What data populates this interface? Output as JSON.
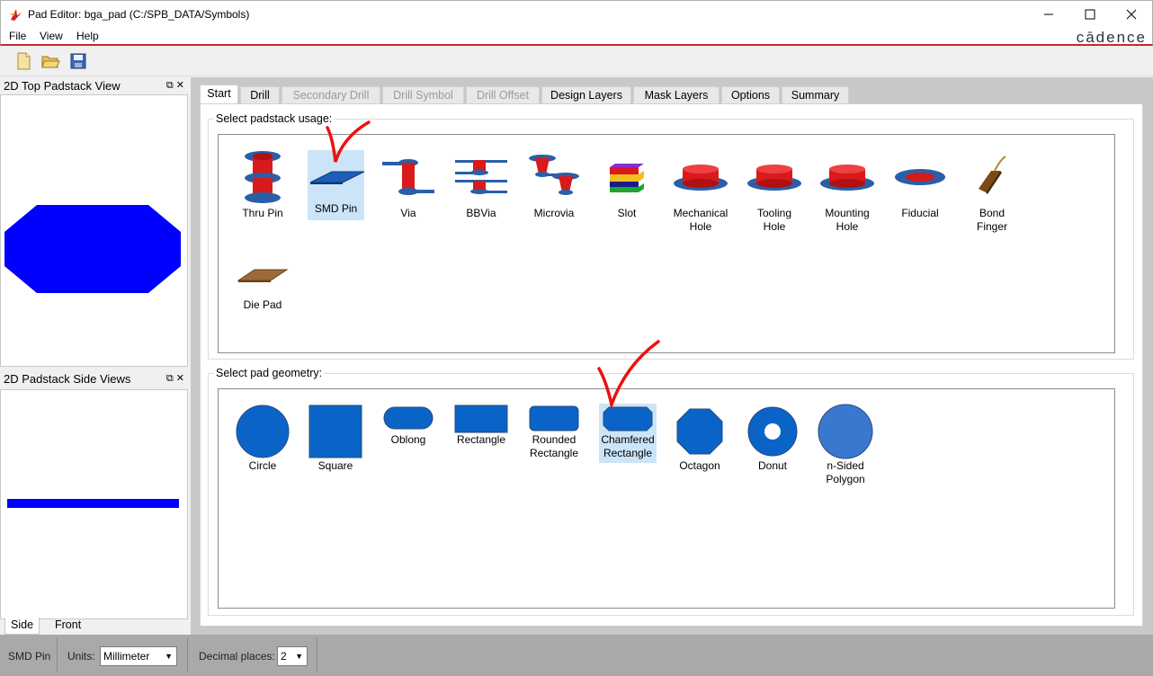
{
  "window": {
    "title": "Pad Editor: bga_pad  (C:/SPB_DATA/Symbols)",
    "brand": "cādence"
  },
  "menu": [
    "File",
    "View",
    "Help"
  ],
  "toolbar": {
    "icons": [
      "new-file-icon",
      "open-folder-icon",
      "save-icon"
    ]
  },
  "panels": {
    "top_view_title": "2D Top Padstack View",
    "side_view_title": "2D Padstack Side Views",
    "side_tabs": [
      "Side",
      "Front"
    ],
    "active_side_tab": "Side",
    "shape_color": "#0000ff"
  },
  "tabs": [
    {
      "label": "Start",
      "enabled": true,
      "active": true
    },
    {
      "label": "Drill",
      "enabled": true
    },
    {
      "label": "Secondary Drill",
      "enabled": false
    },
    {
      "label": "Drill Symbol",
      "enabled": false
    },
    {
      "label": "Drill Offset",
      "enabled": false
    },
    {
      "label": "Design Layers",
      "enabled": true
    },
    {
      "label": "Mask Layers",
      "enabled": true
    },
    {
      "label": "Options",
      "enabled": true
    },
    {
      "label": "Summary",
      "enabled": true
    }
  ],
  "usage": {
    "label": "Select padstack usage:",
    "selected": "SMD Pin",
    "items": [
      {
        "label": "Thru Pin",
        "icon": "thru-pin-icon"
      },
      {
        "label": "SMD Pin",
        "icon": "smd-pin-icon"
      },
      {
        "label": "Via",
        "icon": "via-icon"
      },
      {
        "label": "BBVia",
        "icon": "bbvia-icon"
      },
      {
        "label": "Microvia",
        "icon": "microvia-icon"
      },
      {
        "label": "Slot",
        "icon": "slot-icon"
      },
      {
        "label": "Mechanical\nHole",
        "icon": "mechanical-hole-icon"
      },
      {
        "label": "Tooling\nHole",
        "icon": "tooling-hole-icon"
      },
      {
        "label": "Mounting\nHole",
        "icon": "mounting-hole-icon"
      },
      {
        "label": "Fiducial",
        "icon": "fiducial-icon"
      },
      {
        "label": "Bond\nFinger",
        "icon": "bond-finger-icon"
      },
      {
        "label": "Die Pad",
        "icon": "die-pad-icon"
      }
    ]
  },
  "geometry": {
    "label": "Select pad geometry:",
    "selected": "Chamfered Rectangle",
    "items": [
      {
        "label": "Circle",
        "icon": "circle-icon"
      },
      {
        "label": "Square",
        "icon": "square-icon"
      },
      {
        "label": "Oblong",
        "icon": "oblong-icon"
      },
      {
        "label": "Rectangle",
        "icon": "rectangle-icon"
      },
      {
        "label": "Rounded\nRectangle",
        "icon": "rounded-rectangle-icon"
      },
      {
        "label": "Chamfered\nRectangle",
        "icon": "chamfered-rectangle-icon"
      },
      {
        "label": "Octagon",
        "icon": "octagon-icon"
      },
      {
        "label": "Donut",
        "icon": "donut-icon"
      },
      {
        "label": "n-Sided\nPolygon",
        "icon": "n-sided-polygon-icon"
      }
    ]
  },
  "status": {
    "mode": "SMD Pin",
    "units_label": "Units:",
    "units_value": "Millimeter",
    "decimal_label": "Decimal places:",
    "decimal_value": "2"
  },
  "colors": {
    "pad_blue": "#0a64c8",
    "drill_red": "#e01010",
    "selection": "#cce4f7",
    "annotation_check": "#ee1111",
    "menu_underline": "#c62b2b"
  }
}
